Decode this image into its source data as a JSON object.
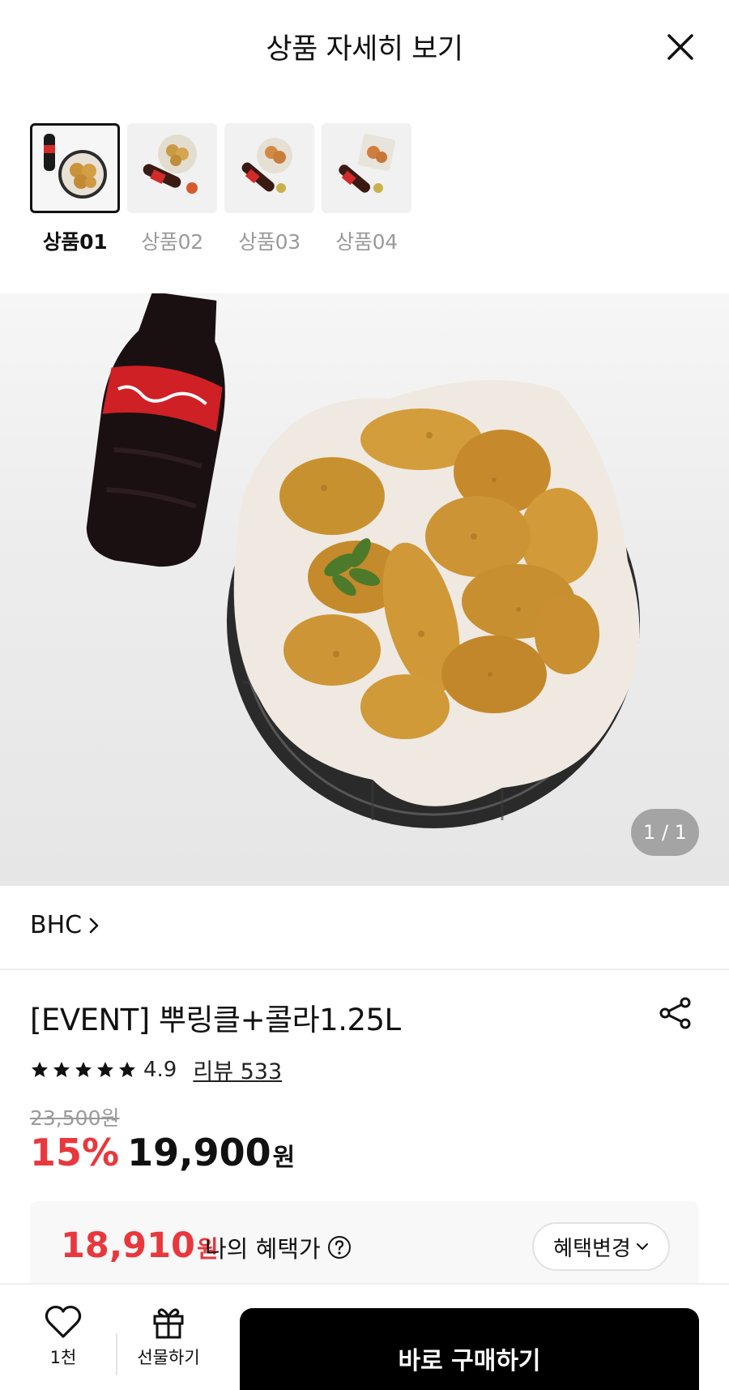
{
  "header": {
    "title": "상품 자세히 보기"
  },
  "thumbnails": [
    {
      "label": "상품01",
      "active": true
    },
    {
      "label": "상품02",
      "active": false
    },
    {
      "label": "상품03",
      "active": false
    },
    {
      "label": "상품04",
      "active": false
    }
  ],
  "gallery": {
    "counter": "1 / 1"
  },
  "brand": {
    "name": "BHC"
  },
  "product": {
    "title": "[EVENT] 뿌링클+콜라1.25L",
    "rating": "4.9",
    "stars": 5,
    "review_text": "리뷰 533",
    "original_price": "23,500원",
    "discount": "15%",
    "price": "19,900",
    "won": "원"
  },
  "benefit": {
    "price": "18,910",
    "won": "원",
    "label": "나의 혜택가",
    "change_button": "혜택변경"
  },
  "bottom_bar": {
    "like_count": "1천",
    "gift_label": "선물하기",
    "buy_label": "바로 구매하기"
  },
  "colors": {
    "accent": "#e8383d",
    "buy_button": "#000000",
    "text": "#111111"
  }
}
